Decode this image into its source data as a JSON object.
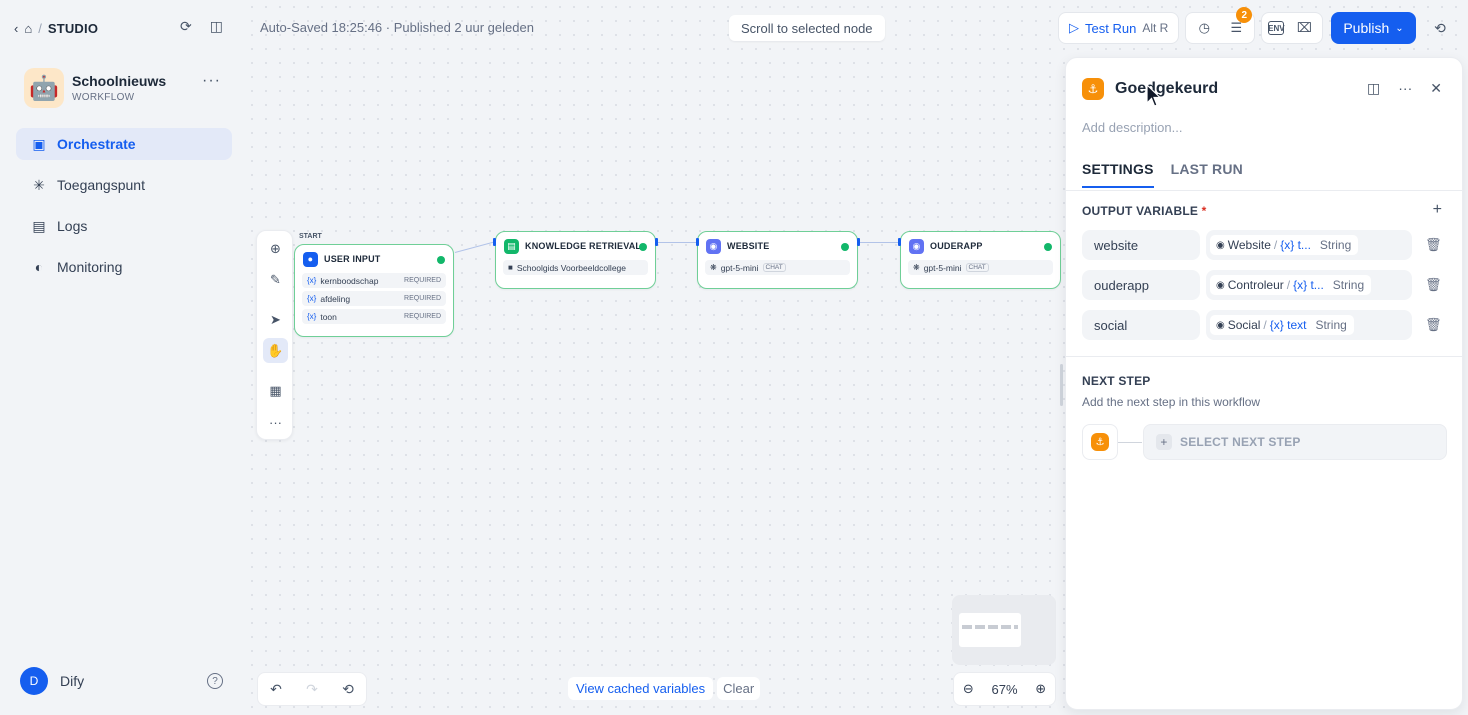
{
  "topbar": {
    "studio_label": "STUDIO",
    "autosave_text": "Auto-Saved 18:25:46 · Published 2 uur geleden",
    "scroll_btn": "Scroll to selected node",
    "test_run_label": "Test Run",
    "test_run_kbd": "Alt R",
    "checklist_badge": "2",
    "env_label": "ENV",
    "publish_label": "Publish"
  },
  "app": {
    "name": "Schoolnieuws",
    "type": "WORKFLOW",
    "avatar_emoji": "🤖"
  },
  "sidebar": {
    "items": [
      {
        "label": "Orchestrate",
        "icon": "layout-icon",
        "active": true
      },
      {
        "label": "Toegangspunt",
        "icon": "asterisk-icon",
        "active": false
      },
      {
        "label": "Logs",
        "icon": "file-list-icon",
        "active": false
      },
      {
        "label": "Monitoring",
        "icon": "gauge-icon",
        "active": false
      }
    ]
  },
  "user": {
    "initial": "D",
    "name": "Dify"
  },
  "canvas": {
    "start_label": "START",
    "nodes": {
      "user_input": {
        "title": "USER INPUT",
        "rows": [
          {
            "name": "kernboodschap",
            "req": "REQUIRED"
          },
          {
            "name": "afdeling",
            "req": "REQUIRED"
          },
          {
            "name": "toon",
            "req": "REQUIRED"
          }
        ]
      },
      "knowledge": {
        "title": "KNOWLEDGE RETRIEVAL",
        "row": "Schoolgids Voorbeeldcollege"
      },
      "website": {
        "title": "WEBSITE",
        "model": "gpt-5-mini",
        "chip": "CHAT"
      },
      "ouderapp": {
        "title": "OUDERAPP",
        "model": "gpt-5-mini",
        "chip": "CHAT"
      }
    },
    "view_cached": "View cached variables",
    "clear": "Clear",
    "zoom": "67%"
  },
  "panel": {
    "title": "Goedgekeurd",
    "description_placeholder": "Add description...",
    "tabs": [
      "SETTINGS",
      "LAST RUN"
    ],
    "output_title": "OUTPUT VARIABLE",
    "required_mark": "*",
    "outputs": [
      {
        "name": "website",
        "source": "Website",
        "var": "{x} t...",
        "type": "String"
      },
      {
        "name": "ouderapp",
        "source": "Controleur",
        "var": "{x} t...",
        "type": "String"
      },
      {
        "name": "social",
        "source": "Social",
        "var": "{x} text",
        "type": "String"
      }
    ],
    "next_title": "NEXT STEP",
    "next_sub": "Add the next step in this workflow",
    "select_next": "SELECT NEXT STEP"
  },
  "colors": {
    "accent": "#155eef",
    "success": "#12b76a",
    "end_node": "#f79009"
  }
}
